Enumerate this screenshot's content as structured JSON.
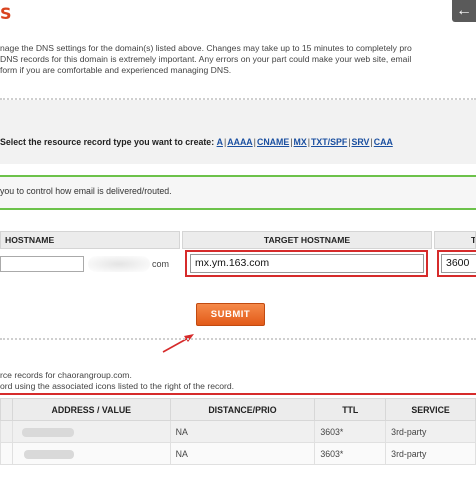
{
  "header": {
    "logo_fragment": "S",
    "back_icon": "back-arrow-icon",
    "back_glyph": "←"
  },
  "intro": {
    "line1": "nage the DNS settings for the domain(s) listed above. Changes may take up to 15 minutes to completely pro",
    "line2": "DNS records for this domain is extremely important. Any errors on your part could make your web site, email",
    "line3": "form if you are comfortable and experienced managing DNS."
  },
  "record_types": {
    "label": "Select the resource record type you want to create:",
    "types": [
      "A",
      "AAAA",
      "CNAME",
      "MX",
      "TXT/SPF",
      "SRV",
      "CAA"
    ],
    "separator": "|"
  },
  "mx_notice": "you to control how email is delivered/routed.",
  "form": {
    "headers": {
      "hostname": "HOSTNAME",
      "target_hostname": "TARGET HOSTNAME",
      "ttl": "TTL"
    },
    "hostname_value": "",
    "domain_suffix": "com",
    "target_value": "mx.ym.163.com",
    "ttl_value": "3600",
    "submit_label": "SUBMIT"
  },
  "records_info": {
    "line1": "rce records for chaorangroup.com.",
    "line2": "ord using the associated icons listed to the right of the record."
  },
  "records_table": {
    "columns": [
      "",
      "ADDRESS / VALUE",
      "DISTANCE/PRIO",
      "TTL",
      "SERVICE"
    ],
    "rows": [
      {
        "distance": "NA",
        "ttl": "3603*",
        "service": "3rd-party"
      },
      {
        "distance": "NA",
        "ttl": "3603*",
        "service": "3rd-party"
      }
    ]
  },
  "colors": {
    "accent_red": "#d62b2b",
    "accent_green": "#6cc24a",
    "submit_orange": "#e25a18",
    "link_blue": "#1a4fa0"
  }
}
